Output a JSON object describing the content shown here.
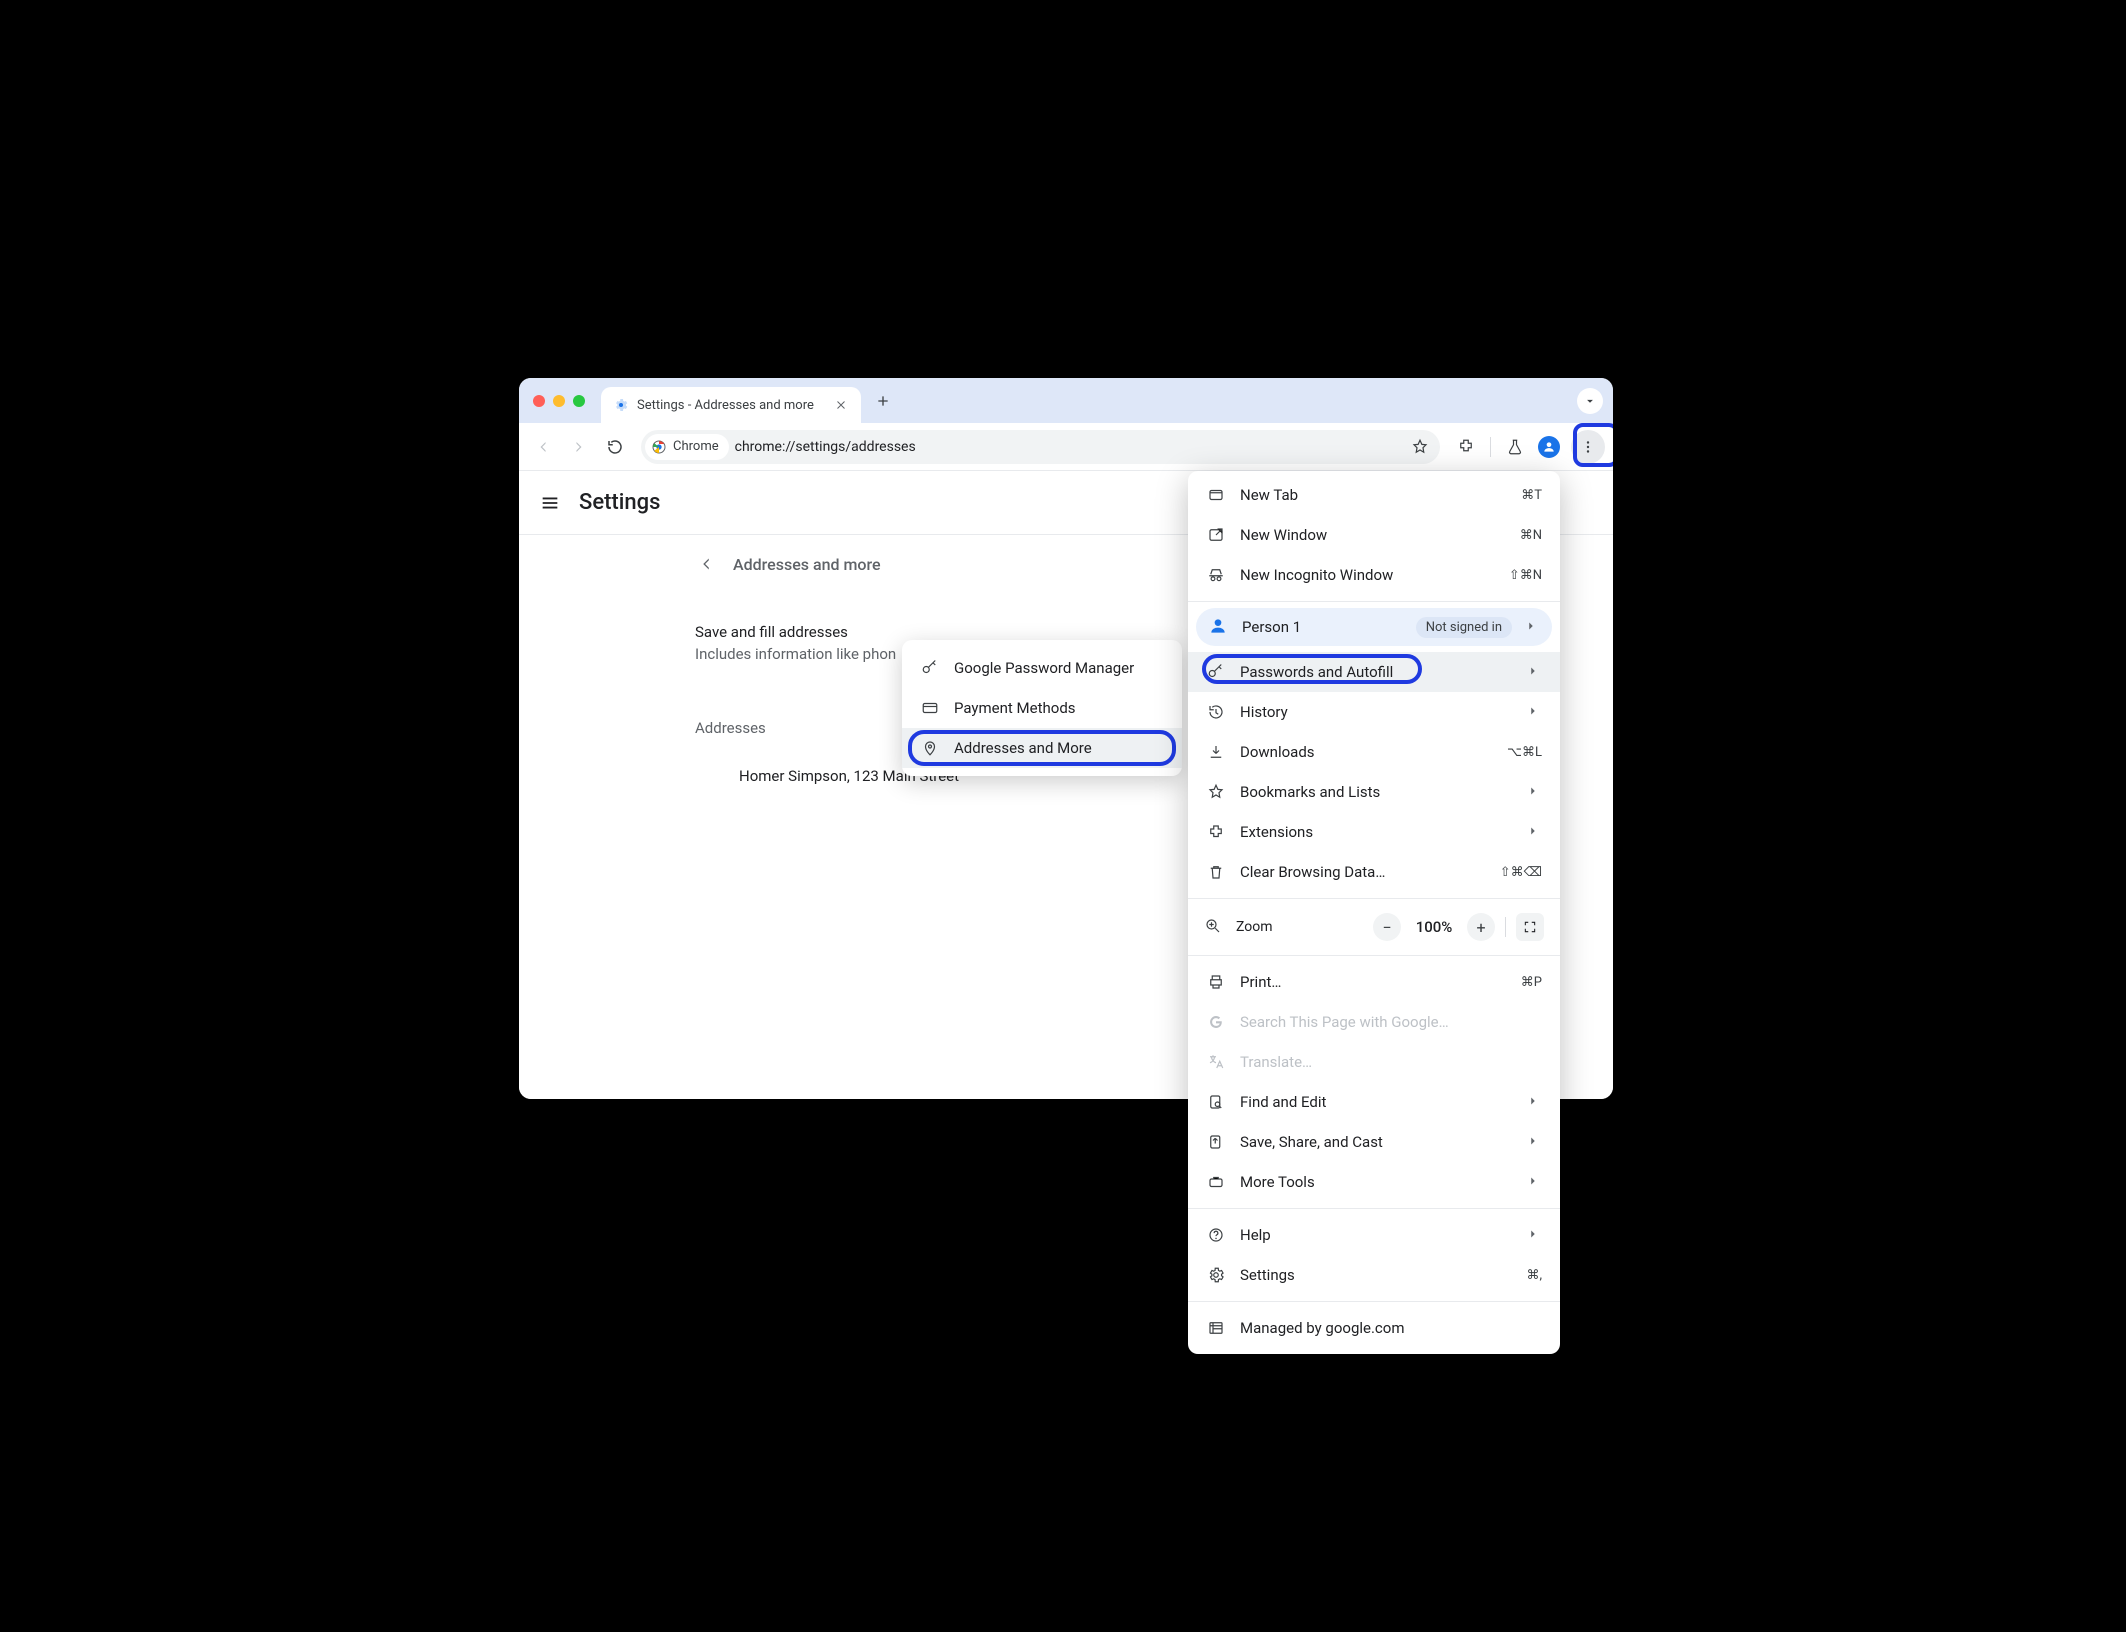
{
  "tab": {
    "title": "Settings - Addresses and more"
  },
  "toolbar": {
    "chrome_chip": "Chrome",
    "url": "chrome://settings/addresses"
  },
  "header": {
    "title": "Settings"
  },
  "section": {
    "crumb": "Addresses and more",
    "subtitle": "Save and fill addresses",
    "subdesc": "Includes information like phon",
    "addresses_label": "Addresses",
    "address_row": "Homer Simpson, 123 Main Street"
  },
  "submenu": {
    "items": [
      {
        "label": "Google Password Manager",
        "icon": "key-icon"
      },
      {
        "label": "Payment Methods",
        "icon": "card-icon"
      },
      {
        "label": "Addresses and More",
        "icon": "pin-icon",
        "highlighted": true,
        "annot": true
      }
    ]
  },
  "mainmenu": {
    "top": [
      {
        "label": "New Tab",
        "icon": "newtab-icon",
        "shortcut": "⌘T"
      },
      {
        "label": "New Window",
        "icon": "newwindow-icon",
        "shortcut": "⌘N"
      },
      {
        "label": "New Incognito Window",
        "icon": "incognito-icon",
        "shortcut": "⇧⌘N"
      }
    ],
    "profile": {
      "name": "Person 1",
      "badge": "Not signed in"
    },
    "mid": [
      {
        "label": "Passwords and Autofill",
        "icon": "key-icon",
        "chevron": true,
        "highlighted": true,
        "annot": true
      },
      {
        "label": "History",
        "icon": "history-icon",
        "chevron": true
      },
      {
        "label": "Downloads",
        "icon": "download-icon",
        "shortcut": "⌥⌘L"
      },
      {
        "label": "Bookmarks and Lists",
        "icon": "star-icon",
        "chevron": true
      },
      {
        "label": "Extensions",
        "icon": "extension-icon",
        "chevron": true
      },
      {
        "label": "Clear Browsing Data…",
        "icon": "trash-icon",
        "shortcut": "⇧⌘⌫"
      }
    ],
    "zoom": {
      "label": "Zoom",
      "value": "100%"
    },
    "lower": [
      {
        "label": "Print…",
        "icon": "print-icon",
        "shortcut": "⌘P"
      },
      {
        "label": "Search This Page with Google…",
        "icon": "google-icon",
        "disabled": true
      },
      {
        "label": "Translate…",
        "icon": "translate-icon",
        "disabled": true
      },
      {
        "label": "Find and Edit",
        "icon": "find-icon",
        "chevron": true
      },
      {
        "label": "Save, Share, and Cast",
        "icon": "share-icon",
        "chevron": true
      },
      {
        "label": "More Tools",
        "icon": "tools-icon",
        "chevron": true
      }
    ],
    "help": [
      {
        "label": "Help",
        "icon": "help-icon",
        "chevron": true
      },
      {
        "label": "Settings",
        "icon": "settings-icon",
        "shortcut": "⌘,"
      }
    ],
    "footer": {
      "label": "Managed by google.com",
      "icon": "managed-icon"
    }
  }
}
